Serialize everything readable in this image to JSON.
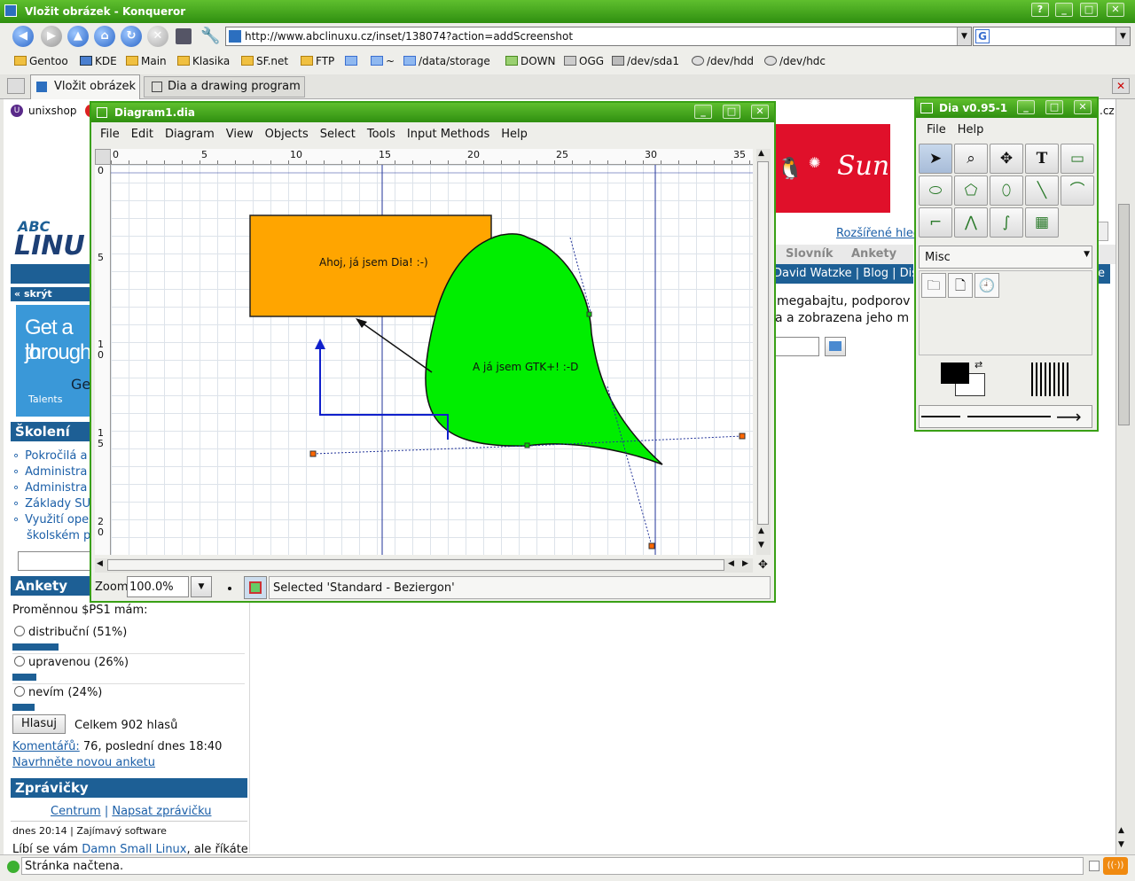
{
  "window": {
    "title": "Vložit obrázek - Konqueror"
  },
  "address": {
    "url": "http://www.abclinuxu.cz/inset/138074?action=addScreenshot"
  },
  "bookmarks": [
    "Gentoo",
    "KDE",
    "Main",
    "Klasika",
    "SF.net",
    "FTP",
    "~",
    "/data/storage",
    "DOWN",
    "OGG",
    "/dev/sda1",
    "/dev/hdd",
    "/dev/hdc"
  ],
  "tabs": [
    "Vložit obrázek",
    "Dia a drawing program"
  ],
  "page": {
    "top_link": "unixshop",
    "hide": "skrýt",
    "banner": {
      "line1": "Get a jo",
      "line2": "through",
      "ge": "Ge",
      "brand": "Talents"
    },
    "training_head": "Školení",
    "courses": [
      "Pokročilá a",
      "Administra",
      "Administra",
      "Základy SU",
      "Využití ope"
    ],
    "course_cont": "školském p",
    "poll_head": "Ankety",
    "poll_question": "Proměnnou $PS1 mám:",
    "poll_options": [
      {
        "label": "distribuční (51%)",
        "value": 51
      },
      {
        "label": "upravenou (26%)",
        "value": 26
      },
      {
        "label": "nevím (24%)",
        "value": 24
      }
    ],
    "vote_btn": "Hlasuj",
    "total": "Celkem 902 hlasů",
    "comments_link": "Komentářů:",
    "comments_rest": " 76, poslední dnes 18:40",
    "suggest": "Navrhněte novou anketu",
    "news_head": "Zprávičky",
    "news_center": "Centrum",
    "news_sep": "|",
    "news_write": "Napsat zprávičku",
    "news_time": "dnes 20:14 | Zajímavý software",
    "news_text1": "Líbí se vám ",
    "news_link": "Damn Small Linux",
    "news_text2": ", ale říkáte",
    "sun": "Sun",
    "search_link": "Rozšířené hled",
    "nav": [
      "Slovník",
      "Ankety"
    ],
    "blue_strip": "David Watzke | Blog | Disk",
    "text_line1": "megabajtu, podporov",
    "text_line2": "a a zobrazena jeho m",
    "cz_tail": ".cz"
  },
  "status": {
    "text": "Stránka načtena."
  },
  "diagram": {
    "title": "Diagram1.dia",
    "menu": [
      "File",
      "Edit",
      "Diagram",
      "View",
      "Objects",
      "Select",
      "Tools",
      "Input Methods",
      "Help"
    ],
    "ruler_h": [
      "0",
      "5",
      "10",
      "15",
      "20",
      "25",
      "30",
      "35"
    ],
    "ruler_v": [
      "0",
      "5",
      "1",
      "0",
      "1",
      "5",
      "2",
      "0"
    ],
    "box_text": "Ahoj, já jsem Dia! :-)",
    "blob_text": "A já jsem GTK+! :-D",
    "zoom_label": "Zoom",
    "zoom_value": "100.0%",
    "status": "Selected 'Standard - Beziergon'",
    "colors": {
      "box": "#ffa500",
      "blob": "#00ee00"
    }
  },
  "toolbox": {
    "title": "Dia v0.95-1",
    "menu": [
      "File",
      "Help"
    ],
    "sheet": "Misc",
    "tool_icons": [
      "pointer-tool-icon",
      "magnify-tool-icon",
      "scroll-tool-icon",
      "text-tool-icon",
      "box-tool-icon",
      "ellipse-tool-icon",
      "polygon-tool-icon",
      "beziergon-tool-icon",
      "line-tool-icon",
      "arc-tool-icon",
      "zigzag-tool-icon",
      "polyline-tool-icon",
      "bezier-tool-icon",
      "image-tool-icon"
    ]
  }
}
